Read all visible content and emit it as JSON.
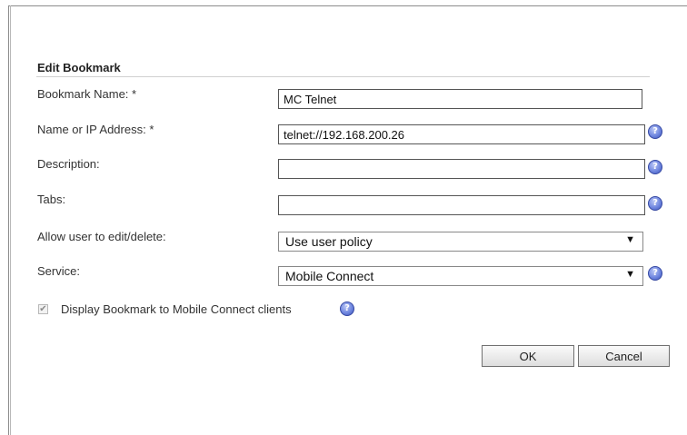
{
  "form": {
    "title": "Edit Bookmark",
    "bookmark_name": {
      "label": "Bookmark Name: *",
      "value": "MC Telnet"
    },
    "address": {
      "label": "Name or IP Address: *",
      "value": "telnet://192.168.200.26",
      "help": "?"
    },
    "description": {
      "label": "Description:",
      "value": "",
      "help": "?"
    },
    "tabs": {
      "label": "Tabs:",
      "value": "",
      "help": "?"
    },
    "allow_edit": {
      "label": "Allow user to edit/delete:",
      "selected": "Use user policy"
    },
    "service": {
      "label": "Service:",
      "selected": "Mobile Connect",
      "help": "?"
    },
    "display_mc": {
      "label": "Display Bookmark to Mobile Connect clients",
      "checked": true,
      "help": "?"
    },
    "ok_label": "OK",
    "cancel_label": "Cancel"
  },
  "colors": {
    "help_icon": "#5a72d4",
    "border": "#555555"
  }
}
